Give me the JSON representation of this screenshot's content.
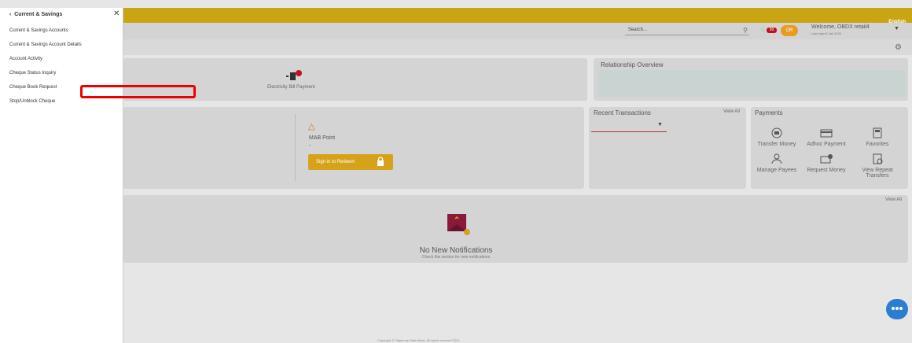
{
  "header": {
    "language": "English",
    "search_placeholder": "Search...",
    "notification_count": "99",
    "avatar_initials": "OR",
    "welcome": "Welcome, OBDX retail4",
    "last_login": "Last login 8 Jan 2024"
  },
  "quick_links": {
    "electricity_bill": "Electricity Bill Payment"
  },
  "relationship": {
    "title": "Relationship Overview"
  },
  "rewards": {
    "mab_label": "MAB Point",
    "mab_value": "-",
    "redeem_label": "Sign in to Redeem"
  },
  "recent_transactions": {
    "title": "Recent Transactions",
    "view_all": "View All"
  },
  "payments": {
    "title": "Payments",
    "items": [
      {
        "label": "Transfer Money"
      },
      {
        "label": "Adhoc Payment"
      },
      {
        "label": "Favorites"
      },
      {
        "label": "Manage Payees"
      },
      {
        "label": "Request Money"
      },
      {
        "label": "View Repeat Transfers"
      }
    ]
  },
  "notifications": {
    "view_all": "View All",
    "title": "No New Notifications",
    "subtitle": "Check this section for new notifications"
  },
  "footer": {
    "text": "Copyright © Zigmoney State Bank. All rights reserved 2024"
  },
  "drawer": {
    "title": "Current & Savings",
    "items": [
      {
        "label": "Current & Savings Accounts"
      },
      {
        "label": "Current & Savings Account Details"
      },
      {
        "label": "Account Activity"
      },
      {
        "label": "Cheque Status Inquiry"
      },
      {
        "label": "Cheque Book Request"
      },
      {
        "label": "Stop/Unblock Cheque"
      }
    ]
  },
  "colors": {
    "brand_gold": "#c9a514",
    "accent_red": "#c0121e",
    "highlight": "#e00000",
    "chat_blue": "#2a7dd1"
  }
}
